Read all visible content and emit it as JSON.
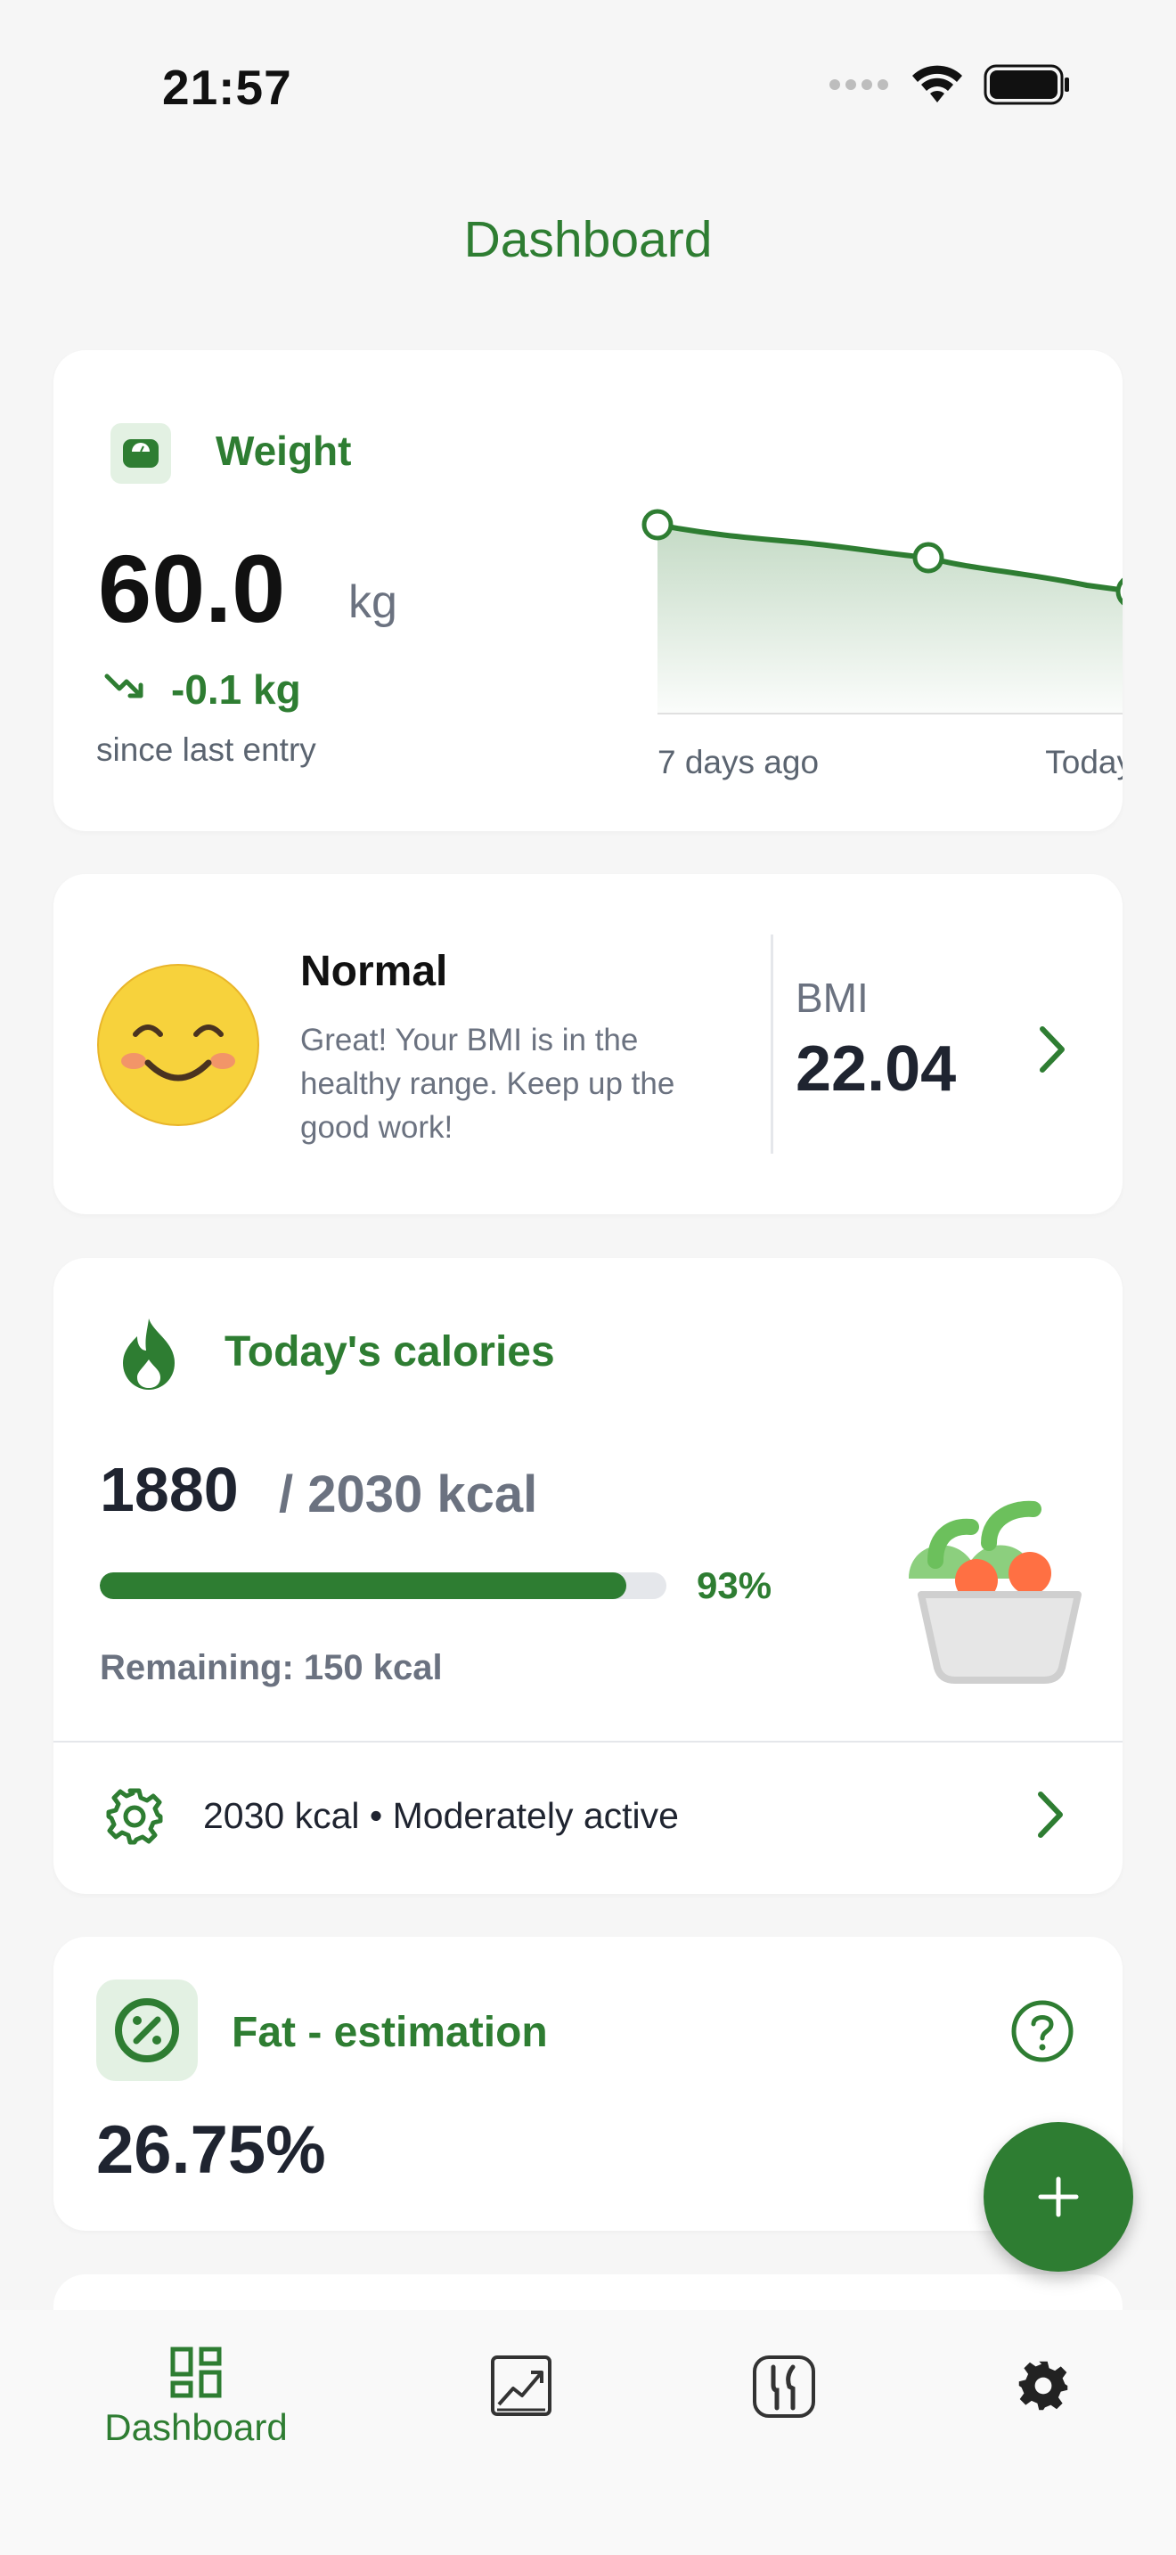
{
  "status_bar": {
    "time": "21:57"
  },
  "header": {
    "title": "Dashboard"
  },
  "weight": {
    "title": "Weight",
    "value": "60.0",
    "unit": "kg",
    "change": "-0.1 kg",
    "since": "since last entry",
    "chart_start_label": "7 days ago",
    "chart_end_label": "Today"
  },
  "bmi": {
    "status": "Normal",
    "description": "Great! Your BMI is in the healthy range. Keep up the good work!",
    "label": "BMI",
    "value": "22.04"
  },
  "calories": {
    "title": "Today's calories",
    "consumed": "1880",
    "goal": "/ 2030 kcal",
    "progress_fraction": 0.93,
    "percent_label": "93%",
    "remaining": "Remaining: 150 kcal",
    "settings_summary": "2030 kcal • Moderately active"
  },
  "fat": {
    "title": "Fat - estimation",
    "value": "26.75%"
  },
  "bottom_nav": {
    "items": [
      {
        "label": "Dashboard",
        "icon": "dashboard-icon",
        "active": true
      },
      {
        "label": "",
        "icon": "chart-icon",
        "active": false
      },
      {
        "label": "",
        "icon": "food-icon",
        "active": false
      },
      {
        "label": "",
        "icon": "settings-icon",
        "active": false
      }
    ]
  },
  "colors": {
    "accent": "#2e7d32",
    "accent_light": "#e3f1e3",
    "background": "#f6f6f6",
    "card": "#ffffff"
  }
}
